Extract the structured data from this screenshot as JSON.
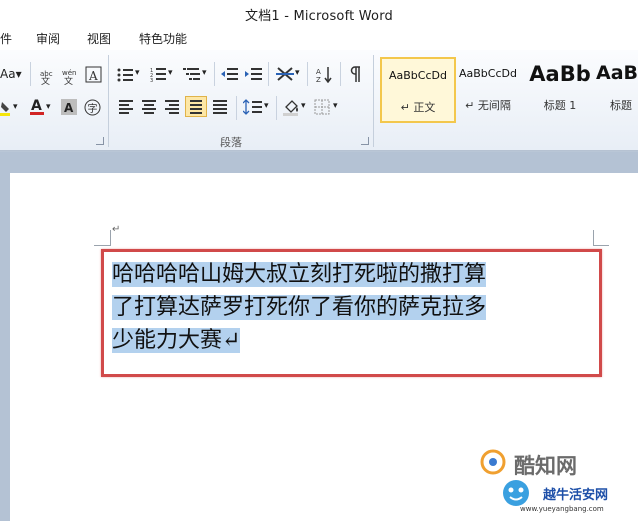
{
  "window": {
    "title": "文档1 - Microsoft Word"
  },
  "menu": {
    "file_partial": "件",
    "review": "审阅",
    "view": "视图",
    "features": "特色功能"
  },
  "ribbon": {
    "font_size_button": "Aa",
    "paragraph_group": "段落",
    "styles": [
      {
        "preview": "AaBbCcDd",
        "label": "↵ 正文",
        "selected": true
      },
      {
        "preview": "AaBbCcDd",
        "label": "↵ 无间隔",
        "selected": false
      },
      {
        "preview": "AaBb",
        "label": "标题 1",
        "selected": false
      },
      {
        "preview": "AaB",
        "label": "标题",
        "selected": false
      }
    ]
  },
  "document": {
    "paragraph_mark": "↵",
    "lines": [
      "哈哈哈哈山姆大叔立刻打死啦的撒打算",
      "了打算达萨罗打死你了看你的萨克拉多",
      "少能力大赛↵"
    ]
  },
  "watermark": {
    "brand": "酷知网",
    "site": "越牛活安网",
    "url": "www.yueyangbang.com"
  },
  "colors": {
    "highlight": "#b3d1ee",
    "annotation": "#d14a4a",
    "style_selected": "#f3c74c"
  }
}
